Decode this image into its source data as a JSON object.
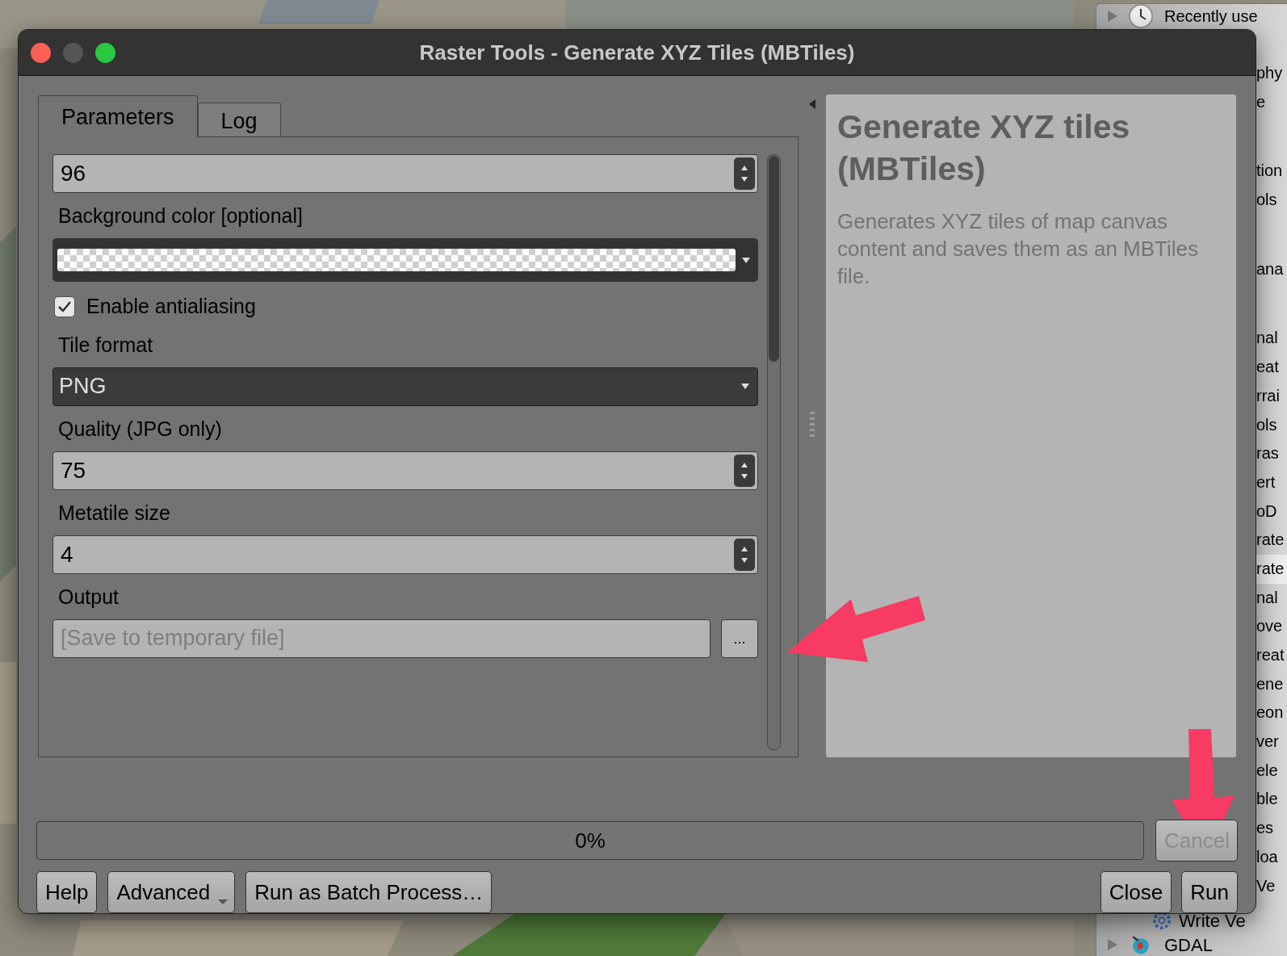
{
  "window": {
    "title": "Raster Tools - Generate XYZ Tiles (MBTiles)"
  },
  "tabs": [
    {
      "label": "Parameters",
      "selected": true
    },
    {
      "label": "Log",
      "selected": false
    }
  ],
  "parameters": [
    {
      "kind": "spin",
      "value": "96"
    },
    {
      "kind": "label",
      "text": "Background color [optional]"
    },
    {
      "kind": "color"
    },
    {
      "kind": "checkbox",
      "label": "Enable antialiasing",
      "checked": true
    },
    {
      "kind": "label",
      "text": "Tile format"
    },
    {
      "kind": "combo",
      "value": "PNG"
    },
    {
      "kind": "label",
      "text": "Quality (JPG only)"
    },
    {
      "kind": "spin",
      "value": "75"
    },
    {
      "kind": "label",
      "text": "Metatile size"
    },
    {
      "kind": "spin",
      "value": "4"
    },
    {
      "kind": "label",
      "text": "Output"
    },
    {
      "kind": "file",
      "placeholder": "[Save to temporary file]",
      "button": "..."
    }
  ],
  "help": {
    "title": "Generate XYZ tiles (MBTiles)",
    "text": "Generates XYZ tiles of map canvas content and saves them as an MBTiles file."
  },
  "progress": {
    "label": "0%",
    "level": 0
  },
  "cancel": {
    "label": "Cancel",
    "disabled": true
  },
  "buttons_left": [
    {
      "label": "Help",
      "menu": false
    },
    {
      "label": "Advanced",
      "menu": true
    },
    {
      "label": "Run as Batch Process…",
      "menu": false
    }
  ],
  "buttons_right": [
    "Close",
    "Run"
  ],
  "side_panel": {
    "header": "Recently use",
    "groups": [
      {
        "items": [
          {
            "text": "phy",
            "selected": false
          },
          {
            "text": "e",
            "selected": false
          }
        ]
      },
      {
        "items": [
          {
            "text": "tion",
            "selected": false
          },
          {
            "text": "ols",
            "selected": false
          }
        ]
      },
      {
        "items": [
          {
            "text": "ana",
            "selected": false
          }
        ]
      },
      {
        "items": [
          {
            "text": "nal",
            "selected": false
          },
          {
            "text": "eat",
            "selected": false
          },
          {
            "text": "rrai",
            "selected": false
          },
          {
            "text": "ols",
            "selected": false
          },
          {
            "text": "ras",
            "selected": false
          },
          {
            "text": "ert",
            "selected": false
          },
          {
            "text": "oD",
            "selected": false
          },
          {
            "text": "rate",
            "selected": false
          },
          {
            "text": "rate",
            "selected": true
          },
          {
            "text": "nal",
            "selected": false
          },
          {
            "text": "ove",
            "selected": false
          },
          {
            "text": "reat",
            "selected": false
          },
          {
            "text": "ene",
            "selected": false
          },
          {
            "text": "eon",
            "selected": false
          },
          {
            "text": "ver",
            "selected": false
          },
          {
            "text": "ele",
            "selected": false
          },
          {
            "text": "ble",
            "selected": false
          },
          {
            "text": "es",
            "selected": false
          },
          {
            "text": "loa",
            "selected": false
          },
          {
            "text": "Ve",
            "selected": false
          }
        ]
      }
    ],
    "tool": "Write Ve",
    "provider": "GDAL"
  }
}
